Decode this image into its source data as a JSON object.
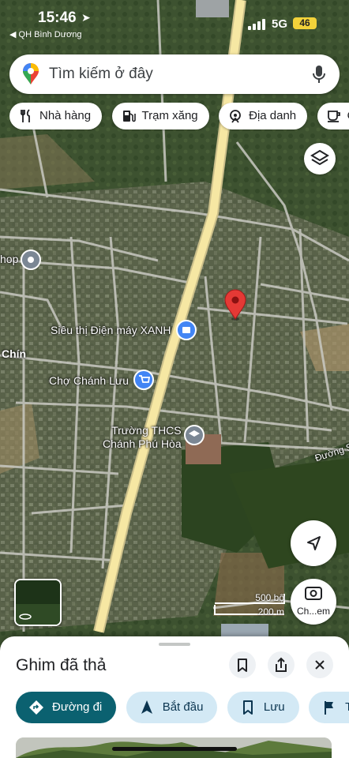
{
  "status_bar": {
    "time": "15:46",
    "back_app": "◀ QH Bình Dương",
    "network": "5G",
    "battery": "46"
  },
  "search": {
    "placeholder": "Tìm kiếm ở đây"
  },
  "chips": [
    {
      "label": "Nhà hàng",
      "icon": "restaurant-icon"
    },
    {
      "label": "Trạm xăng",
      "icon": "gas-station-icon"
    },
    {
      "label": "Địa danh",
      "icon": "landmark-icon"
    },
    {
      "label": "Quán c",
      "icon": "coffee-icon"
    }
  ],
  "map": {
    "labels": {
      "shop": "hop",
      "dienmay": "Siêu thị Điện máy XANH",
      "chin": "Chín",
      "cho": "Chợ Chánh Lưu",
      "school": "Trường THCS\nChánh Phú Hòa",
      "duong": "Đường S"
    },
    "scale": {
      "top": "500 bộ",
      "bottom": "200 m"
    },
    "lens_label": "Ch...em"
  },
  "sheet": {
    "title": "Ghim đã thả",
    "actions": [
      {
        "label": "Đường đi",
        "icon": "directions-icon"
      },
      {
        "label": "Bắt đầu",
        "icon": "navigation-arrow-icon"
      },
      {
        "label": "Lưu",
        "icon": "bookmark-icon"
      },
      {
        "label": "Thên",
        "icon": "flag-icon"
      }
    ]
  },
  "colors": {
    "pin": "#e53935",
    "road_main": "#f6e7a3",
    "primary_action": "#0b6170",
    "secondary_action": "#d3e9f5"
  }
}
